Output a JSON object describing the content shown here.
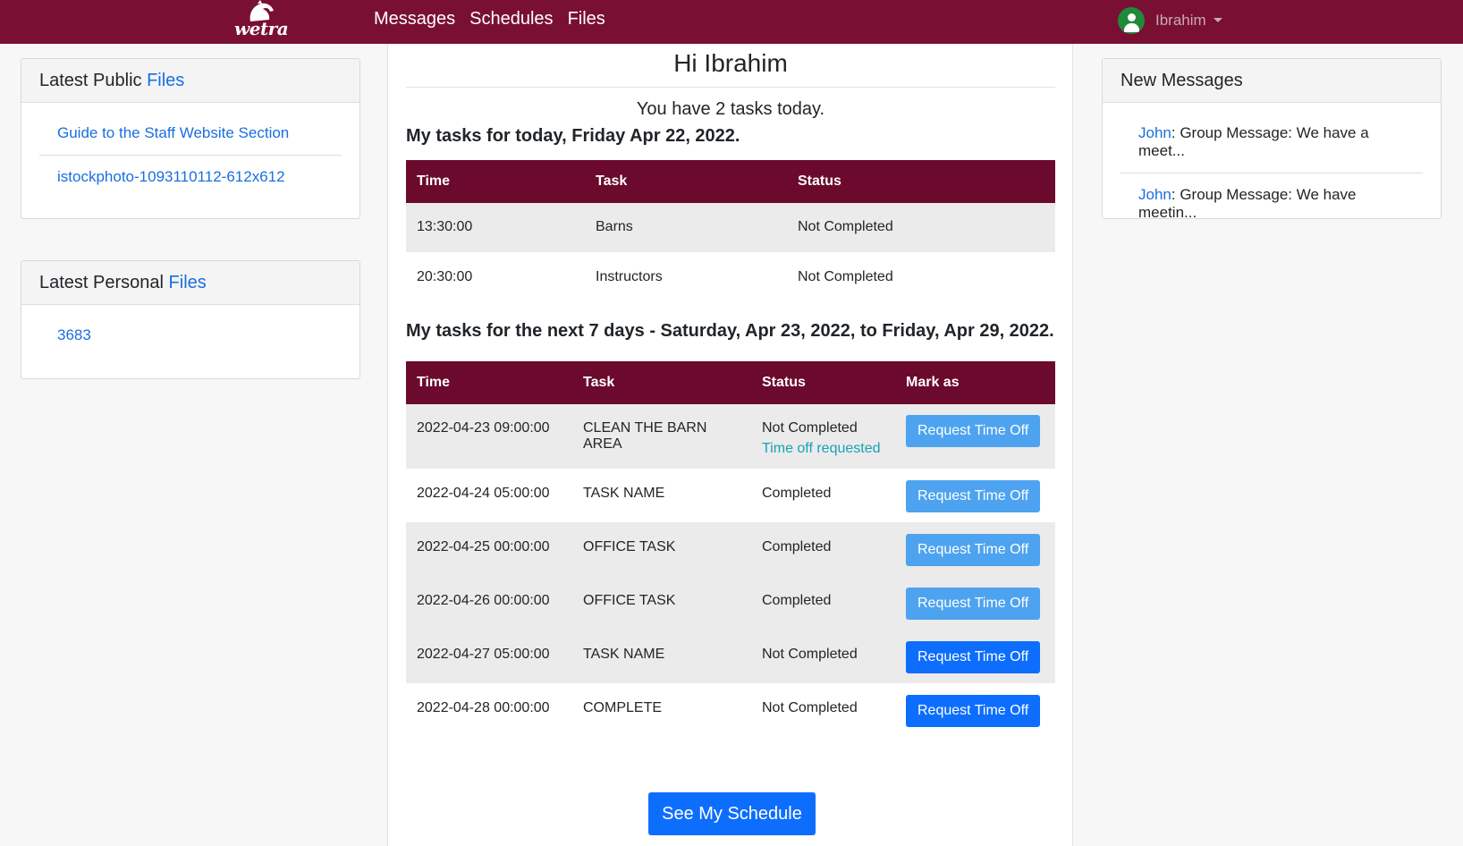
{
  "brand": {
    "logo_text": "wetra"
  },
  "nav": {
    "links": [
      "Messages",
      "Schedules",
      "Files"
    ]
  },
  "user": {
    "name": "Ibrahim"
  },
  "left": {
    "public_files": {
      "title": "Latest Public ",
      "title_link": "Files",
      "items": [
        "Guide to the Staff Website Section",
        "istockphoto-1093110112-612x612"
      ]
    },
    "personal_files": {
      "title": "Latest Personal ",
      "title_link": "Files",
      "items": [
        "3683"
      ]
    }
  },
  "center": {
    "greeting": "Hi Ibrahim",
    "tasks_count": "You have 2 tasks today.",
    "today_title": "My tasks for today, Friday Apr 22, 2022.",
    "today_headers": [
      "Time",
      "Task",
      "Status"
    ],
    "today_rows": [
      {
        "time": "13:30:00",
        "task": "Barns",
        "status": "Not Completed"
      },
      {
        "time": "20:30:00",
        "task": "Instructors",
        "status": "Not Completed"
      }
    ],
    "week_title": "My tasks for the next 7 days - Saturday, Apr 23, 2022, to Friday, Apr 29, 2022.",
    "week_headers": [
      "Time",
      "Task",
      "Status",
      "Mark as"
    ],
    "week_rows": [
      {
        "time": "2022-04-23 09:00:00",
        "task": "CLEAN THE BARN AREA",
        "status": "Not Completed",
        "note": "Time off requested",
        "button": "Request Time Off"
      },
      {
        "time": "2022-04-24 05:00:00",
        "task": "TASK NAME",
        "status": "Completed",
        "note": "",
        "button": "Request Time Off"
      },
      {
        "time": "2022-04-25 00:00:00",
        "task": "OFFICE TASK",
        "status": "Completed",
        "note": "",
        "button": "Request Time Off"
      },
      {
        "time": "2022-04-26 00:00:00",
        "task": "OFFICE TASK",
        "status": "Completed",
        "note": "",
        "button": "Request Time Off"
      },
      {
        "time": "2022-04-27 05:00:00",
        "task": "TASK NAME",
        "status": "Not Completed",
        "note": "",
        "button": "Request Time Off"
      },
      {
        "time": "2022-04-28 00:00:00",
        "task": "COMPLETE",
        "status": "Not Completed",
        "note": "",
        "button": "Request Time Off"
      }
    ],
    "schedule_button": "See My Schedule"
  },
  "right": {
    "messages": {
      "title": "New Messages",
      "items": [
        {
          "sender": "John",
          "sep": ": ",
          "text": "Group Message: We have a meet..."
        },
        {
          "sender": "John",
          "sep": ": ",
          "text": "Group Message: We have meetin..."
        }
      ]
    }
  },
  "colors": {
    "navbar": "#7a0f34",
    "table_header": "#6b0a2c",
    "link": "#1a6fe0",
    "button": "#0d6efd",
    "button_light": "#4da3ef",
    "note": "#17a2b8"
  }
}
